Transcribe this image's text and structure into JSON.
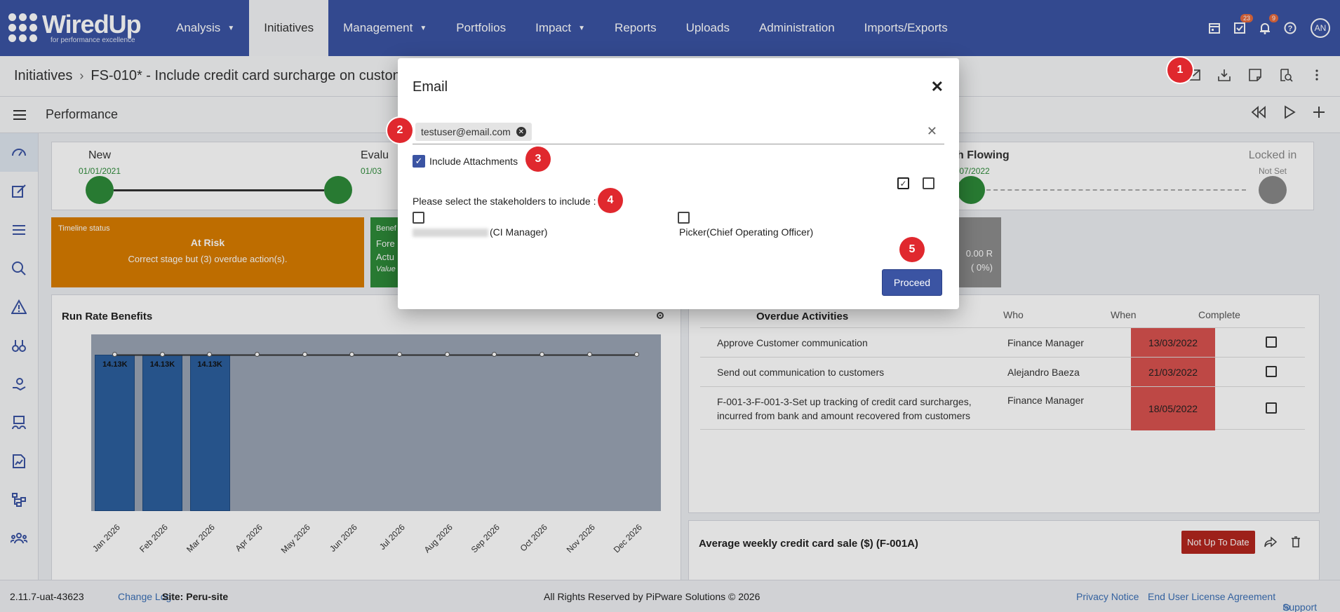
{
  "app": {
    "name": "WiredUp",
    "tagline": "for performance excellence"
  },
  "nav": {
    "items": [
      {
        "label": "Analysis",
        "dropdown": true
      },
      {
        "label": "Initiatives",
        "active": true
      },
      {
        "label": "Management",
        "dropdown": true
      },
      {
        "label": "Portfolios"
      },
      {
        "label": "Impact",
        "dropdown": true
      },
      {
        "label": "Reports"
      },
      {
        "label": "Uploads"
      },
      {
        "label": "Administration"
      },
      {
        "label": "Imports/Exports"
      }
    ],
    "task_badge": "23",
    "notif_badge": "9",
    "avatar": "AN"
  },
  "breadcrumb": {
    "root": "Initiatives",
    "current": "FS-010* - Include credit card surcharge on custon"
  },
  "perf": {
    "title": "Performance"
  },
  "stages": [
    {
      "name": "New",
      "date": "01/01/2021"
    },
    {
      "name": "Evalu",
      "date": "01/03"
    },
    {
      "name": "h Flowing",
      "date": "/07/2022"
    },
    {
      "name": "Locked in",
      "date": "Not Set"
    }
  ],
  "timeline": {
    "label": "Timeline status",
    "status": "At Risk",
    "desc": "Correct stage but (3) overdue action(s)."
  },
  "benefit_card": {
    "label": "Benef",
    "line1": "Fore",
    "line2": "Actu",
    "line3": "Value"
  },
  "gray_card": {
    "value": "0.00 R",
    "pct": "( 0%)"
  },
  "run_rate": {
    "title": "Run Rate Benefits"
  },
  "chart_data": {
    "type": "bar",
    "categories": [
      "Jan 2026",
      "Feb 2026",
      "Mar 2026",
      "Apr 2026",
      "May 2026",
      "Jun 2026",
      "Jul 2026",
      "Aug 2026",
      "Sep 2026",
      "Oct 2026",
      "Nov 2026",
      "Dec 2026"
    ],
    "values": [
      14.13,
      14.13,
      14.13,
      null,
      null,
      null,
      null,
      null,
      null,
      null,
      null,
      null
    ],
    "value_labels": [
      "14.13K",
      "14.13K",
      "14.13K"
    ],
    "line_values": [
      14.13,
      14.13,
      14.13,
      14.13,
      14.13,
      14.13,
      14.13,
      14.13,
      14.13,
      14.13,
      14.13,
      14.13
    ],
    "ylim": [
      0,
      16
    ]
  },
  "overdue": {
    "title": "Overdue Activities",
    "headers": {
      "who": "Who",
      "when": "When",
      "complete": "Complete"
    },
    "rows": [
      {
        "activity": "Approve Customer communication",
        "who": "Finance Manager",
        "when": "13/03/2022"
      },
      {
        "activity": "Send out communication to customers",
        "who": "Alejandro Baeza",
        "when": "21/03/2022"
      },
      {
        "activity": "F-001-3-F-001-3-Set up tracking of credit card surcharges, incurred from bank and amount recovered from customers",
        "who": "Finance Manager",
        "when": "18/05/2022"
      }
    ]
  },
  "avg_weekly": {
    "title": "Average weekly credit card sale ($) (F-001A)",
    "badge": "Not Up To Date"
  },
  "footer": {
    "version": "2.11.7-uat-43623",
    "changelog": "Change Log",
    "site": "Site: Peru-site",
    "rights": "All Rights Reserved by PiPware Solutions © 2026",
    "privacy": "Privacy Notice",
    "eula": "End User License Agreement",
    "support": "Support"
  },
  "email_modal": {
    "title": "Email",
    "recipient": "testuser@email.com",
    "include_attachments": "Include Attachments",
    "stakeholder_prompt": "Please select the stakeholders to include :",
    "stakeholders": [
      {
        "label": "(CI Manager)",
        "name_redacted": true
      },
      {
        "label": "Picker(Chief Operating Officer)"
      }
    ],
    "proceed": "Proceed"
  },
  "markers": [
    "1",
    "2",
    "3",
    "4",
    "5"
  ],
  "colors": {
    "primary": "#3b54a3",
    "marker": "#e0282e",
    "at_risk": "#d97d00",
    "overdue": "#d9534f"
  }
}
